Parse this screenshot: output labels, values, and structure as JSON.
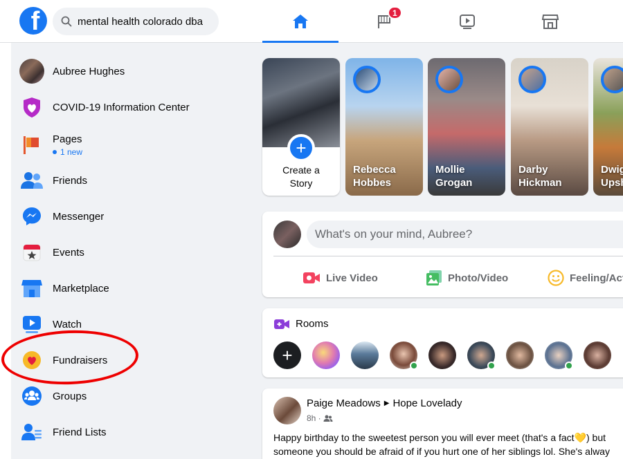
{
  "header": {
    "search_value": "mental health colorado dba",
    "nav_badge": "1"
  },
  "sidebar": {
    "items": [
      {
        "label": "Aubree Hughes"
      },
      {
        "label": "COVID-19 Information Center"
      },
      {
        "label": "Pages",
        "sub": "1 new"
      },
      {
        "label": "Friends"
      },
      {
        "label": "Messenger"
      },
      {
        "label": "Events"
      },
      {
        "label": "Marketplace"
      },
      {
        "label": "Watch"
      },
      {
        "label": "Fundraisers"
      },
      {
        "label": "Groups"
      },
      {
        "label": "Friend Lists"
      }
    ]
  },
  "stories": {
    "create_line1": "Create a",
    "create_line2": "Story",
    "items": [
      {
        "first": "Rebecca",
        "last": "Hobbes"
      },
      {
        "first": "Mollie",
        "last": "Grogan"
      },
      {
        "first": "Darby",
        "last": "Hickman"
      },
      {
        "first": "Dwig",
        "last": "Upsh"
      }
    ]
  },
  "composer": {
    "placeholder": "What's on your mind, Aubree?",
    "actions": [
      "Live Video",
      "Photo/Video",
      "Feeling/Activity"
    ]
  },
  "rooms": {
    "title": "Rooms"
  },
  "post": {
    "author": "Paige Meadows",
    "target": "Hope Lovelady",
    "time": "8h ·",
    "line1": "Happy birthday to the sweetest person you will ever meet (that's a fact💛) but",
    "line2": "someone you should be afraid of if you hurt one of her siblings lol. She's alway"
  },
  "colors": {
    "brand": "#1877f2",
    "badge": "#e41e3f",
    "annotation": "#e00000",
    "online": "#31a24c"
  }
}
